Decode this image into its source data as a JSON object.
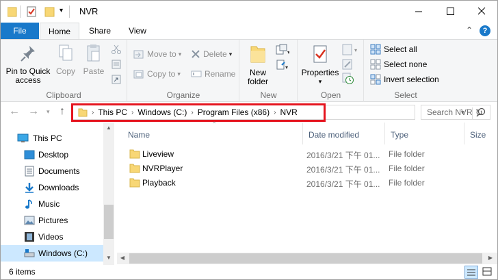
{
  "window": {
    "title": "NVR",
    "minimize_icon": "minimize-icon",
    "maximize_icon": "maximize-icon",
    "close_icon": "close-icon"
  },
  "ribbon_tabs": {
    "file": "File",
    "home": "Home",
    "share": "Share",
    "view": "View",
    "help": "?"
  },
  "clipboard": {
    "pin_label": "Pin to Quick access",
    "copy_label": "Copy",
    "paste_label": "Paste",
    "group_label": "Clipboard"
  },
  "organize": {
    "move_to": "Move to",
    "copy_to": "Copy to",
    "delete": "Delete",
    "rename": "Rename",
    "group_label": "Organize"
  },
  "new_group": {
    "new_folder": "New folder",
    "group_label": "New"
  },
  "open_group": {
    "properties": "Properties",
    "group_label": "Open"
  },
  "select_group": {
    "select_all": "Select all",
    "select_none": "Select none",
    "invert_selection": "Invert selection",
    "group_label": "Select"
  },
  "address": {
    "crumbs": [
      "This PC",
      "Windows (C:)",
      "Program Files (x86)",
      "NVR"
    ],
    "search_placeholder": "Search NVR"
  },
  "nav_pane": {
    "items": [
      {
        "label": "This PC",
        "icon": "pc-icon"
      },
      {
        "label": "Desktop",
        "icon": "desktop-icon"
      },
      {
        "label": "Documents",
        "icon": "documents-icon"
      },
      {
        "label": "Downloads",
        "icon": "downloads-icon"
      },
      {
        "label": "Music",
        "icon": "music-icon"
      },
      {
        "label": "Pictures",
        "icon": "pictures-icon"
      },
      {
        "label": "Videos",
        "icon": "videos-icon"
      },
      {
        "label": "Windows (C:)",
        "icon": "drive-icon"
      }
    ]
  },
  "file_list": {
    "columns": [
      "Name",
      "Date modified",
      "Type",
      "Size"
    ],
    "rows": [
      {
        "name": "Liveview",
        "date": "2016/3/21 下午 01...",
        "type": "File folder"
      },
      {
        "name": "NVRPlayer",
        "date": "2016/3/21 下午 01...",
        "type": "File folder"
      },
      {
        "name": "Playback",
        "date": "2016/3/21 下午 01...",
        "type": "File folder"
      }
    ]
  },
  "status": {
    "item_count": "6 items"
  },
  "colors": {
    "accent": "#1979ca",
    "highlight": "#e5141e",
    "folder": "#f8d775",
    "header_text": "#4c607a"
  }
}
